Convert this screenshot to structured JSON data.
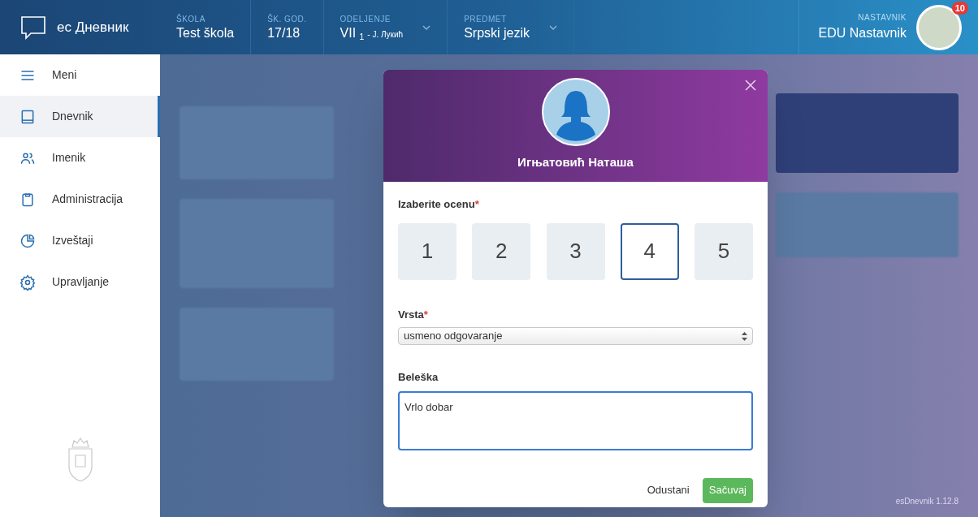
{
  "app": {
    "logo_text": "ес Дневник"
  },
  "header_fields": [
    {
      "label": "ŠKOLA",
      "value": "Test škola",
      "dropdown": false
    },
    {
      "label": "ŠK. GOD.",
      "value": "17/18",
      "dropdown": false
    },
    {
      "label": "ODELJENJE",
      "value": "VII",
      "subscript": "1",
      "note": "- J. Лукић",
      "dropdown": true
    },
    {
      "label": "PREDMET",
      "value": "Srpski jezik",
      "dropdown": true
    }
  ],
  "user": {
    "role": "NASTAVNIK",
    "name": "EDU Nastavnik",
    "badge": "10"
  },
  "sidebar": {
    "items": [
      {
        "kind": "menu",
        "label": "Meni",
        "selected": false
      },
      {
        "kind": "book",
        "label": "Dnevnik",
        "selected": true
      },
      {
        "kind": "people",
        "label": "Imenik",
        "selected": false
      },
      {
        "kind": "clipboard",
        "label": "Administracija",
        "selected": false
      },
      {
        "kind": "chart",
        "label": "Izveštaji",
        "selected": false
      },
      {
        "kind": "gear",
        "label": "Upravljanje",
        "selected": false
      }
    ]
  },
  "modal": {
    "student_name": "Игњатовић Наташа",
    "grade_field": {
      "label": "Izaberite ocenu",
      "mark": "*"
    },
    "grades": [
      {
        "label": "1",
        "selected": false
      },
      {
        "label": "2",
        "selected": false
      },
      {
        "label": "3",
        "selected": false
      },
      {
        "label": "4",
        "selected": true
      },
      {
        "label": "5",
        "selected": false
      }
    ],
    "type_field": {
      "label": "Vrsta",
      "mark": "*",
      "value": "usmeno odgovaranje"
    },
    "note_field": {
      "label": "Beleška",
      "value": "Vrlo dobar"
    },
    "buttons": {
      "cancel": "Odustani",
      "save": "Sačuvaj"
    }
  },
  "footer": {
    "version": "esDnevnik 1.12.8"
  }
}
